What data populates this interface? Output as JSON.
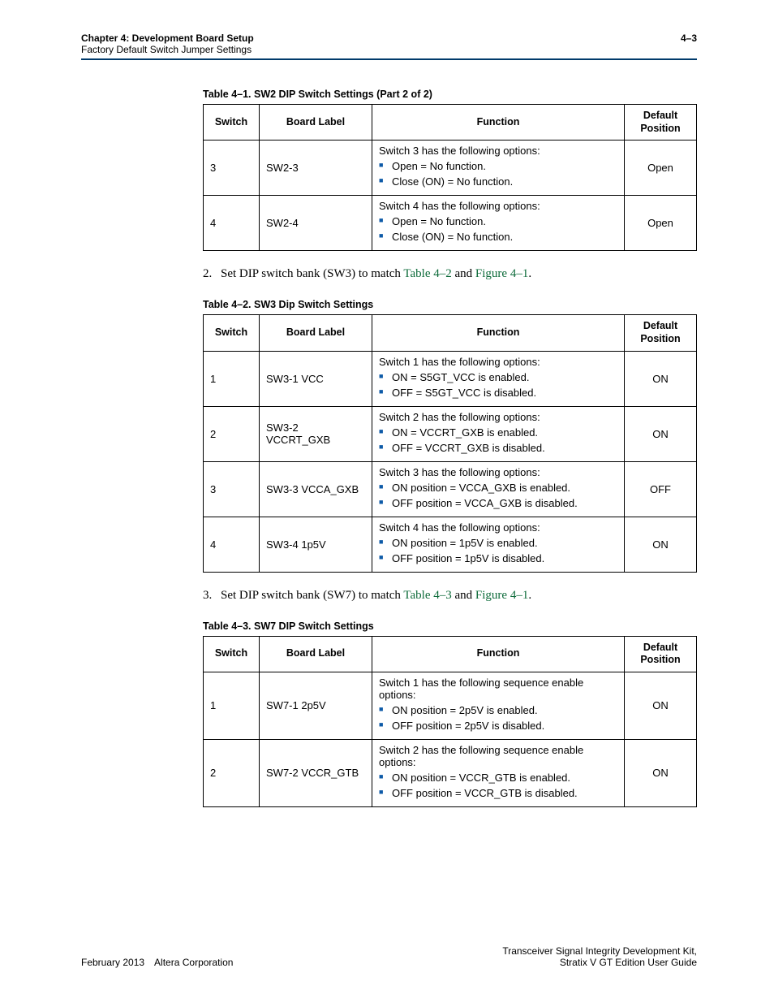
{
  "header": {
    "chapter": "Chapter 4:  Development Board Setup",
    "section": "Factory Default Switch Jumper Settings",
    "page_num": "4–3"
  },
  "table41": {
    "title": "Table 4–1.  SW2 DIP Switch Settings  (Part 2 of 2)",
    "headers": {
      "switch": "Switch",
      "label": "Board Label",
      "function": "Function",
      "default": "Default Position"
    },
    "rows": [
      {
        "switch": "3",
        "label": "SW2-3",
        "lead": "Switch 3 has the following options:",
        "opts": [
          "Open = No function.",
          "Close (ON) = No function."
        ],
        "default": "Open"
      },
      {
        "switch": "4",
        "label": "SW2-4",
        "lead": "Switch 4 has the following options:",
        "opts": [
          "Open = No function.",
          "Close (ON) = No function."
        ],
        "default": "Open"
      }
    ]
  },
  "step2": {
    "num": "2.",
    "text_pre": "Set DIP switch bank (SW3) to match ",
    "xref1": "Table 4–2",
    "mid": " and ",
    "xref2": "Figure 4–1",
    "post": "."
  },
  "table42": {
    "title": "Table 4–2.  SW3 Dip Switch Settings",
    "headers": {
      "switch": "Switch",
      "label": "Board Label",
      "function": "Function",
      "default": "Default Position"
    },
    "rows": [
      {
        "switch": "1",
        "label": "SW3-1 VCC",
        "lead": "Switch 1 has the following options:",
        "opts": [
          "ON = S5GT_VCC is enabled.",
          "OFF = S5GT_VCC is disabled."
        ],
        "default": "ON"
      },
      {
        "switch": "2",
        "label": "SW3-2 VCCRT_GXB",
        "lead": "Switch 2 has the following options:",
        "opts": [
          "ON = VCCRT_GXB is enabled.",
          "OFF = VCCRT_GXB is disabled."
        ],
        "default": "ON"
      },
      {
        "switch": "3",
        "label": "SW3-3 VCCA_GXB",
        "lead": "Switch 3 has the following options:",
        "opts": [
          "ON position = VCCA_GXB is enabled.",
          "OFF position = VCCA_GXB is disabled."
        ],
        "default": "OFF"
      },
      {
        "switch": "4",
        "label": "SW3-4 1p5V",
        "lead": "Switch 4 has the following options:",
        "opts": [
          "ON position = 1p5V is enabled.",
          "OFF position = 1p5V is disabled."
        ],
        "default": "ON"
      }
    ]
  },
  "step3": {
    "num": "3.",
    "text_pre": "Set DIP switch bank (SW7) to match ",
    "xref1": "Table 4–3",
    "mid": " and ",
    "xref2": "Figure 4–1",
    "post": "."
  },
  "table43": {
    "title": "Table 4–3.  SW7 DIP Switch Settings",
    "headers": {
      "switch": "Switch",
      "label": "Board Label",
      "function": "Function",
      "default": "Default Position"
    },
    "rows": [
      {
        "switch": "1",
        "label": "SW7-1 2p5V",
        "lead": "Switch 1 has the following sequence enable options:",
        "opts": [
          "ON position = 2p5V is enabled.",
          "OFF position = 2p5V is disabled."
        ],
        "default": "ON"
      },
      {
        "switch": "2",
        "label": "SW7-2 VCCR_GTB",
        "lead": "Switch 2 has the following sequence enable options:",
        "opts": [
          "ON position = VCCR_GTB is enabled.",
          "OFF position = VCCR_GTB is disabled."
        ],
        "default": "ON"
      }
    ]
  },
  "footer": {
    "left": "February 2013 Altera Corporation",
    "right1": "Transceiver Signal Integrity Development Kit,",
    "right2": "Stratix V GT Edition User Guide"
  }
}
